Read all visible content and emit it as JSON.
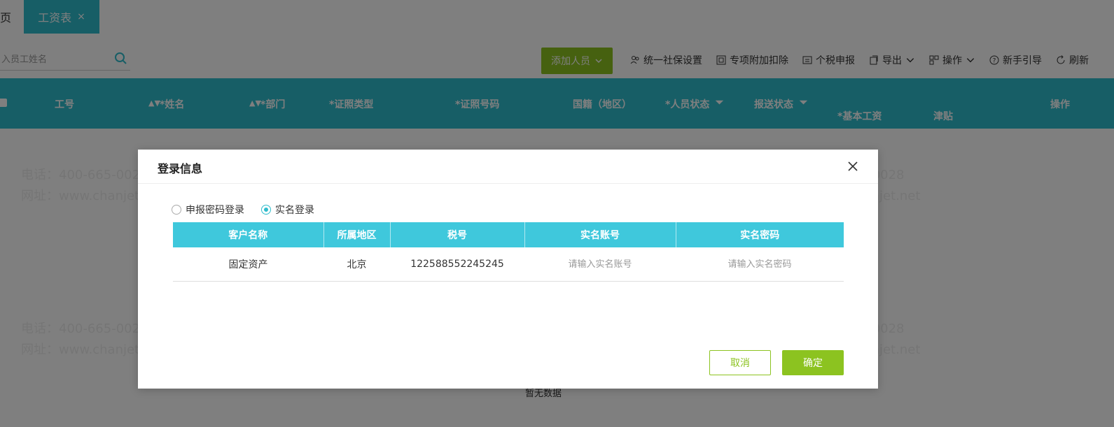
{
  "tabs": {
    "home": "页",
    "active": "工资表",
    "close": "×"
  },
  "search": {
    "placeholder": "入员工姓名"
  },
  "toolbar": {
    "add_label": "添加人员",
    "social_insurance": "统一社保设置",
    "special_deduction": "专项附加扣除",
    "tax_declaration": "个税申报",
    "export": "导出",
    "operate": "操作",
    "guide": "新手引导",
    "refresh": "刷新"
  },
  "table_header": {
    "emp_no": "工号",
    "name": "*姓名",
    "dept": "*部门",
    "id_type": "*证照类型",
    "id_no": "*证照号码",
    "nationality": "国籍（地区）",
    "person_status": "*人员状态",
    "report_status": "报送状态",
    "base_salary": "*基本工资",
    "allowance": "津贴",
    "actions": "操作"
  },
  "empty_text": "暂无数据",
  "watermark": {
    "phone": "电话：400-665-0028",
    "site": "网址：www.chanjet.net"
  },
  "dialog": {
    "title": "登录信息",
    "radios": [
      {
        "label": "申报密码登录",
        "checked": false
      },
      {
        "label": "实名登录",
        "checked": true
      }
    ],
    "columns": [
      "客户名称",
      "所属地区",
      "税号",
      "实名账号",
      "实名密码"
    ],
    "row": {
      "customer": "固定资产",
      "region": "北京",
      "tax_no": "122588552245245",
      "account_placeholder": "请输入实名账号",
      "password_placeholder": "请输入实名密码"
    },
    "cancel_label": "取消",
    "ok_label": "确定"
  },
  "colors": {
    "teal": "#2fbccc",
    "green": "#8cc320"
  }
}
